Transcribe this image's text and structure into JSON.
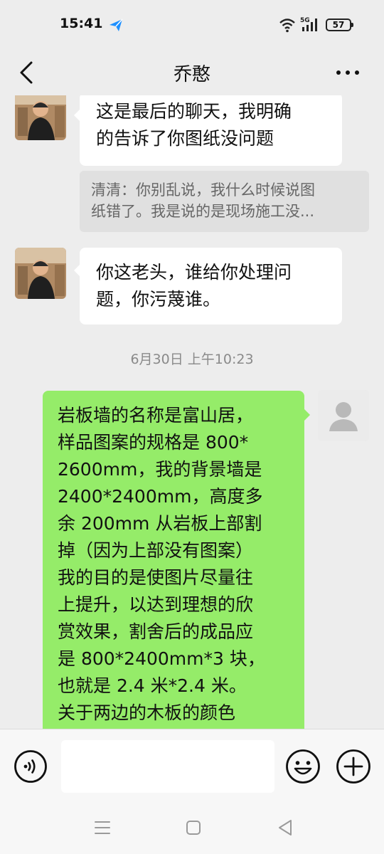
{
  "status_bar": {
    "time": "15:41",
    "network": "5G",
    "battery": "57"
  },
  "nav": {
    "title": "乔憨",
    "back_icon": "chevron-left-icon",
    "more_icon": "more-dots-icon"
  },
  "messages": [
    {
      "side": "left",
      "lines": [
        "这是最后的聊天，我明确",
        "的告诉了你图纸没问题"
      ]
    },
    {
      "type": "quote",
      "lines": [
        "清清：你别乱说，我什么时候说图",
        "纸错了。我是说的是现场施工没..."
      ]
    },
    {
      "side": "left",
      "lines": [
        "你这老头，谁给你处理问",
        "题，你污蔑谁。"
      ]
    },
    {
      "type": "timestamp",
      "text": "6月30日 上午10:23"
    },
    {
      "side": "right",
      "lines": [
        "岩板墙的名称是富山居，",
        "样品图案的规格是 800*",
        "2600mm，我的背景墙是",
        "2400*2400mm，高度多",
        "余 200mm 从岩板上部割",
        "掉（因为上部没有图案）",
        "我的目的是使图片尽量往",
        "上提升，以达到理想的欣",
        "赏效果，割舍后的成品应",
        "是 800*2400mm*3 块，",
        "也就是 2.4 米*2.4 米。",
        "关于两边的木板的颜色"
      ]
    }
  ],
  "input_bar": {
    "voice_icon": "voice-icon",
    "input_value": "",
    "emoji_icon": "emoji-icon",
    "plus_icon": "plus-icon"
  },
  "system_nav": {
    "menu_icon": "menu-icon",
    "home_icon": "home-icon",
    "back_icon": "back-triangle-icon"
  },
  "colors": {
    "background": "#ededed",
    "bubble_white": "#ffffff",
    "bubble_green": "#95ec69",
    "quote_bg": "#e0e0e0",
    "timestamp": "#8a8a8a"
  }
}
